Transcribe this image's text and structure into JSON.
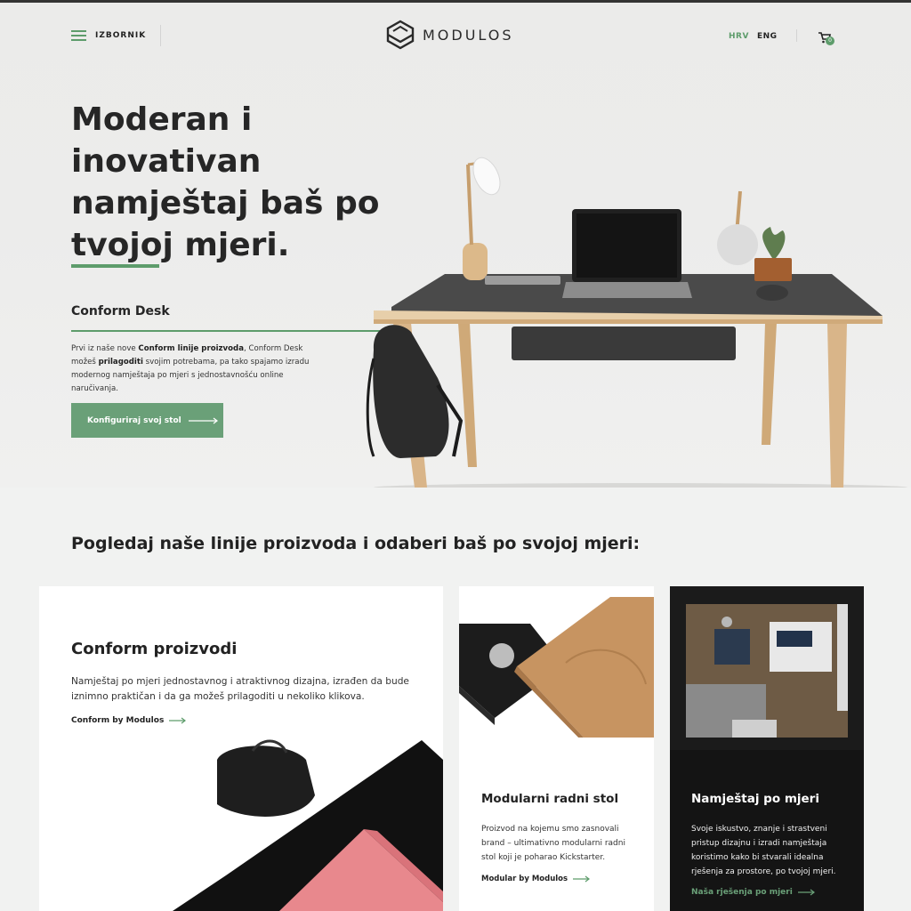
{
  "colors": {
    "accent": "#5d9c6b",
    "button": "#6aa078",
    "dark_card": "#141414",
    "text": "#222222"
  },
  "header": {
    "menu_label": "IZBORNIK",
    "logo_text": "MODULOS",
    "languages": [
      "HRV",
      "ENG"
    ],
    "active_language": "HRV",
    "cart_count": "0",
    "icons": [
      "hamburger-icon",
      "logo-mark-icon",
      "cart-icon"
    ]
  },
  "hero": {
    "title_lines": [
      "Moderan i",
      "inovativan",
      "namještaj baš po",
      "tvojoj mjeri."
    ],
    "product_name": "Conform Desk",
    "desc": {
      "part1": "Prvi iz naše nove ",
      "bold1": "Conform linije proizvoda",
      "part2": ", Conform Desk možeš ",
      "bold2": "prilagoditi",
      "part3": " svojim potrebama, pa tako spajamo izradu modernog namještaja po mjeri s jednostavnošću online naručivanja."
    },
    "cta_label": "Konfiguriraj svoj stol"
  },
  "products": {
    "heading": "Pogledaj naše linije proizvoda i odaberi baš po svojoj mjeri:",
    "cards": [
      {
        "title": "Conform proizvodi",
        "text": "Namještaj po mjeri jednostavnog i atraktivnog dizajna, izrađen da bude iznimno praktičan i da ga možeš prilagoditi u nekoliko klikova.",
        "link": "Conform by Modulos"
      },
      {
        "title": "Modularni radni stol",
        "text": "Proizvod na kojemu smo zasnovali brand – ultimativno modularni radni stol koji je poharao Kickstarter.",
        "link": "Modular by Modulos"
      },
      {
        "title": "Namještaj po mjeri",
        "text": "Svoje iskustvo, znanje i strastveni pristup dizajnu i izradi namještaja koristimo kako bi stvarali idealna rješenja za prostore, po tvojoj mjeri.",
        "link": "Naša rješenja po mjeri"
      }
    ]
  }
}
